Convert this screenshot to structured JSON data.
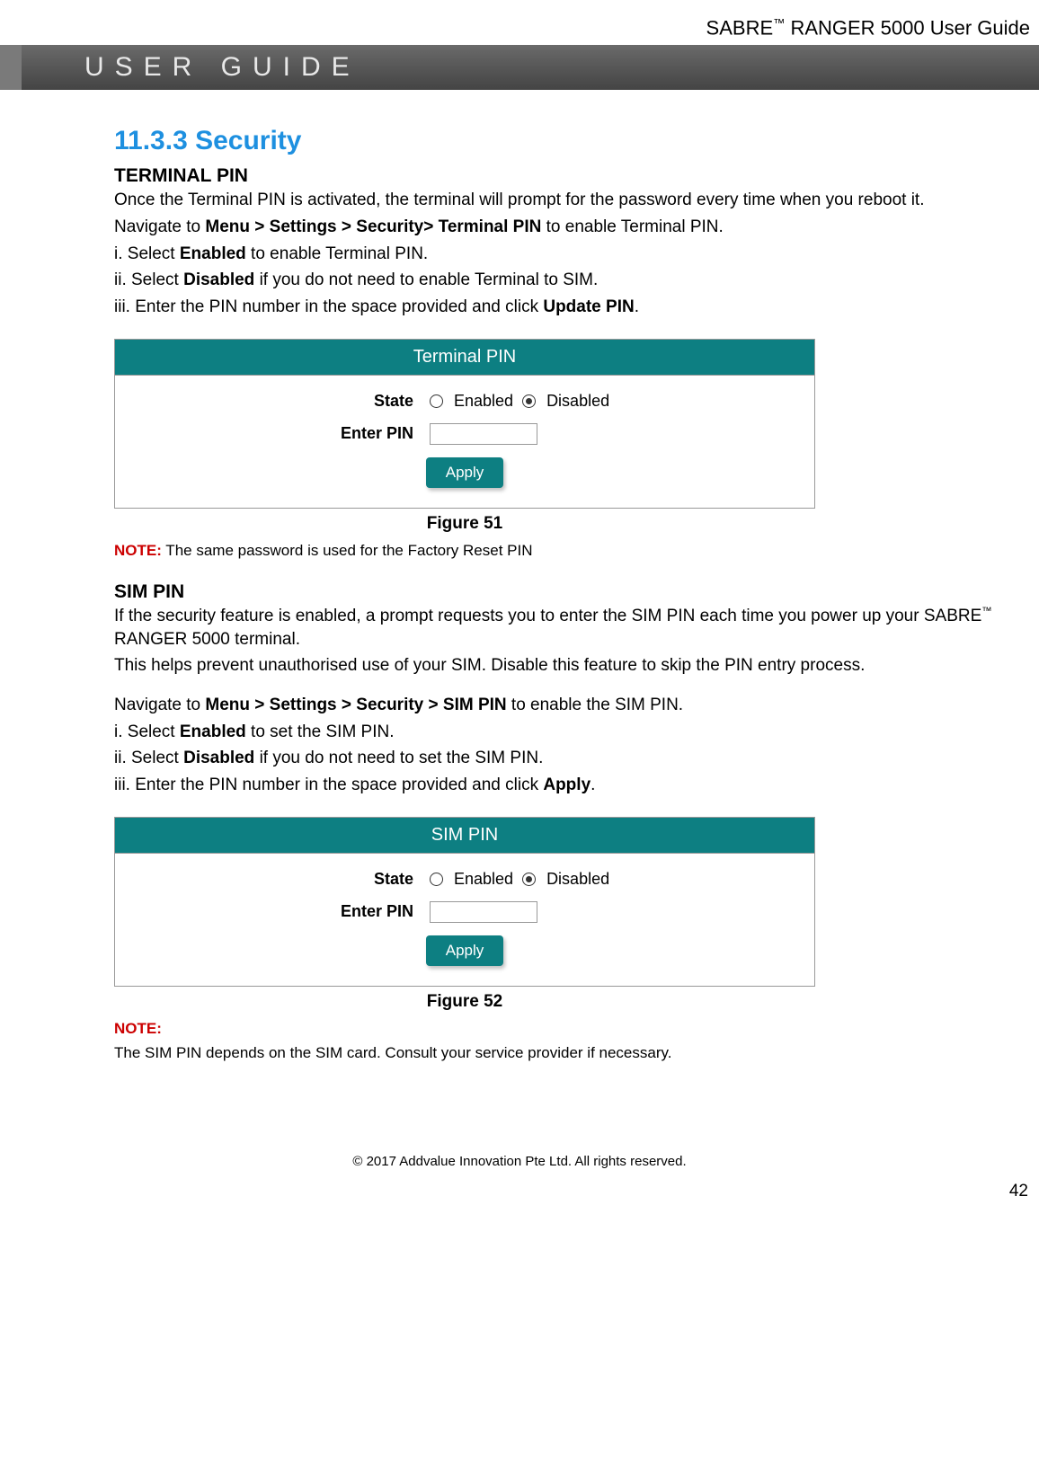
{
  "header": {
    "product": "SABRE",
    "trademark": "™",
    "suffix": " RANGER 5000 User Guide"
  },
  "banner": {
    "text": "USER GUIDE"
  },
  "section": {
    "title": "11.3.3 Security"
  },
  "terminal": {
    "heading": "TERMINAL PIN",
    "p1": "Once the Terminal PIN is activated, the terminal will prompt for the password every time when you reboot it.",
    "nav_pre": "Navigate to ",
    "nav_bold": "Menu > Settings > Security> Terminal PIN",
    "nav_post": " to enable Terminal PIN.",
    "i_pre": "i. Select ",
    "i_bold": "Enabled",
    "i_post": " to enable Terminal PIN.",
    "ii_pre": "ii. Select ",
    "ii_bold": "Disabled",
    "ii_post": " if you do not need to enable Terminal to SIM.",
    "iii_pre": "iii. Enter the PIN number in the space provided and click ",
    "iii_bold": "Update PIN",
    "iii_post": "."
  },
  "fig51": {
    "panel_title": "Terminal PIN",
    "state_label": "State",
    "enabled": "Enabled",
    "disabled": "Disabled",
    "enter_pin": "Enter PIN",
    "apply": "Apply",
    "caption": "Figure 51"
  },
  "note1": {
    "label": "NOTE:",
    "text": " The same password is used for the Factory Reset PIN"
  },
  "sim": {
    "heading": "SIM PIN",
    "p1_pre": "If the security feature is enabled, a prompt requests you to enter the SIM PIN each time you power up your SABRE",
    "p1_tm": "™",
    "p1_post": " RANGER 5000 terminal.",
    "p2": "This helps prevent unauthorised use of your SIM. Disable this feature to skip the PIN entry process.",
    "nav_pre": "Navigate to ",
    "nav_bold": "Menu > Settings > Security > SIM PIN",
    "nav_post": " to enable the SIM PIN.",
    "i_pre": "i. Select ",
    "i_bold": "Enabled",
    "i_post": " to set the SIM PIN.",
    "ii_pre": "ii. Select ",
    "ii_bold": "Disabled",
    "ii_post": " if you do not need to set the SIM PIN.",
    "iii_pre": "iii. Enter the PIN number in the space provided and click ",
    "iii_bold": "Apply",
    "iii_post": "."
  },
  "fig52": {
    "panel_title": "SIM PIN",
    "state_label": "State",
    "enabled": "Enabled",
    "disabled": "Disabled",
    "enter_pin": "Enter PIN",
    "apply": "Apply",
    "caption": "Figure 52"
  },
  "note2": {
    "label": "NOTE:",
    "text": "The SIM PIN depends on the SIM card. Consult your service provider if necessary."
  },
  "footer": {
    "copyright": "© 2017 Addvalue Innovation Pte Ltd. All rights reserved."
  },
  "page": {
    "number": "42"
  }
}
